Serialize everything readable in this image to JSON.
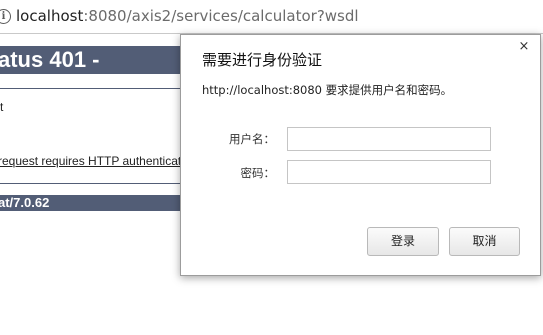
{
  "address_bar": {
    "host": "localhost",
    "path": ":8080/axis2/services/calculator?wsdl"
  },
  "background_page": {
    "heading": "atus 401 -",
    "text_fragment": "t",
    "description": " request requires HTTP authentication",
    "footer": "at/7.0.62"
  },
  "dialog": {
    "title": "需要进行身份验证",
    "close": "×",
    "message": "http://localhost:8080 要求提供用户名和密码。",
    "username_label": "用户名：",
    "username_value": "",
    "password_label": "密码：",
    "password_value": "",
    "login_button": "登录",
    "cancel_button": "取消"
  }
}
